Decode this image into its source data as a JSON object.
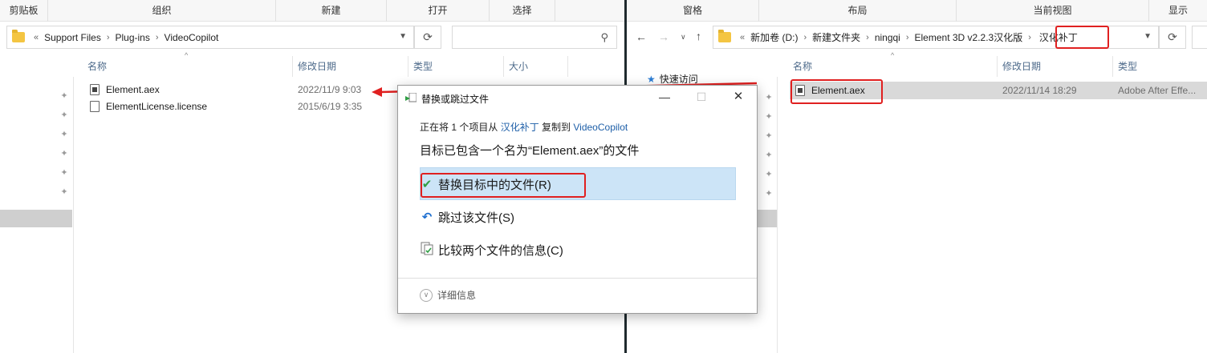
{
  "left_window": {
    "ribbon": [
      "剪贴板",
      "组织",
      "新建",
      "打开",
      "选择"
    ],
    "path": [
      "Support Files",
      "Plug-ins",
      "VideoCopilot"
    ],
    "path_overflow": "«",
    "columns": [
      "名称",
      "修改日期",
      "类型",
      "大小"
    ],
    "files": [
      {
        "name": "Element.aex",
        "date": "2022/11/9 9:03"
      },
      {
        "name": "ElementLicense.license",
        "date": "2015/6/19 3:35"
      }
    ]
  },
  "right_window": {
    "ribbon": [
      "窗格",
      "布局",
      "当前视图",
      "显示"
    ],
    "path": [
      "新加卷 (D:)",
      "新建文件夹",
      "ningqi",
      "Element 3D v2.2.3汉化版",
      "汉化补丁"
    ],
    "path_overflow": "«",
    "quick_access": "快速访问",
    "columns": [
      "名称",
      "修改日期",
      "类型"
    ],
    "files": [
      {
        "name": "Element.aex",
        "date": "2022/11/14 18:29",
        "type": "Adobe After Effe..."
      }
    ]
  },
  "dialog": {
    "title": "替换或跳过文件",
    "line1_prefix": "正在将 1 个项目从 ",
    "line1_source": "汉化补丁",
    "line1_middle": " 复制到 ",
    "line1_dest": "VideoCopilot",
    "heading": "目标已包含一个名为“Element.aex”的文件",
    "options": [
      {
        "label": "替换目标中的文件(R)",
        "icon": "checkmark-icon"
      },
      {
        "label": "跳过该文件(S)",
        "icon": "skip-arrow-icon"
      },
      {
        "label": "比较两个文件的信息(C)",
        "icon": "compare-files-icon"
      }
    ],
    "details": "详细信息"
  },
  "colors": {
    "highlight_red": "#e02020",
    "link_blue": "#1e5fa8",
    "option_selected_bg": "#cce4f7",
    "check_green": "#2f9e44"
  }
}
